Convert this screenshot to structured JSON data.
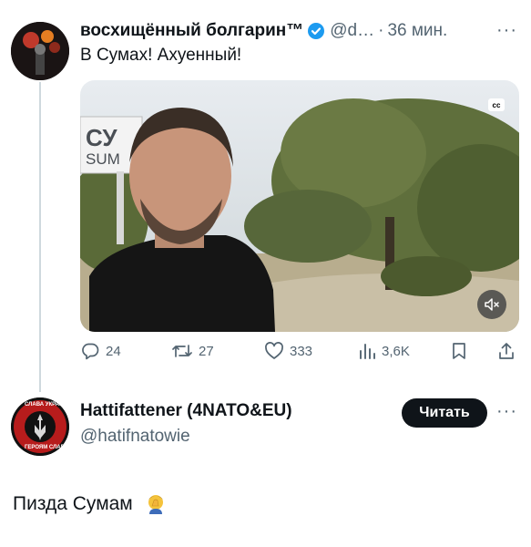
{
  "tweet1": {
    "display_name": "восхищённый болгарин™",
    "handle": "@d…",
    "separator": "·",
    "time": "36 мин.",
    "text": "В Сумах! Ахуенный!",
    "media": {
      "sign_line1": "СУ",
      "sign_line2": "SUM",
      "cc_label": "cc"
    },
    "actions": {
      "replies": "24",
      "retweets": "27",
      "likes": "333",
      "views": "3,6K"
    }
  },
  "tweet2": {
    "display_name": "Hattifattener (4NATO&EU)",
    "handle": "@hatifnatowie",
    "follow_label": "Читать",
    "text": "Пизда Сумам",
    "emoji": "🤦‍♂️",
    "avatar_text_top": "СЛАВА УКРАЇНІ",
    "avatar_text_bottom": "ГЕРОЯМ СЛАВА"
  },
  "colors": {
    "muted": "#536471",
    "verified": "#1d9bf0",
    "button": "#0f1419",
    "thread_line": "#cfd9de"
  },
  "icons": [
    "verified-icon",
    "more-icon",
    "reply-icon",
    "retweet-icon",
    "like-icon",
    "views-icon",
    "bookmark-icon",
    "share-icon",
    "mute-icon",
    "cc-icon"
  ]
}
